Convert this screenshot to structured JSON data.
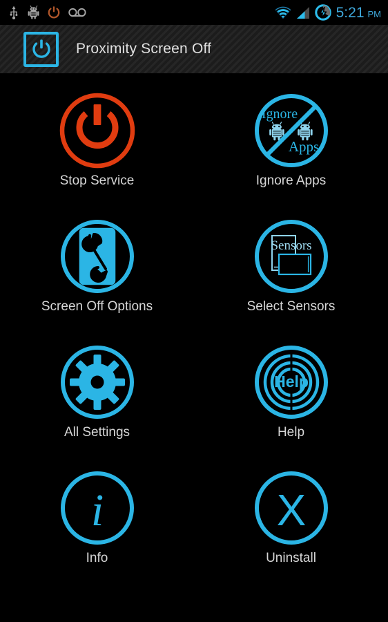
{
  "status_bar": {
    "left_icons": [
      {
        "name": "usb-icon",
        "label": "USB"
      },
      {
        "name": "android-debug-icon",
        "label": "Android debugging"
      },
      {
        "name": "power-notification-icon",
        "label": "Power"
      },
      {
        "name": "voicemail-icon",
        "label": "Voicemail"
      }
    ],
    "right_icons": [
      {
        "name": "wifi-icon",
        "label": "Wi-Fi"
      },
      {
        "name": "signal-icon",
        "label": "Mobile signal"
      },
      {
        "name": "battery-charging-icon",
        "label": "Battery charging"
      }
    ],
    "time": "5:21",
    "ampm": "PM",
    "accent_color": "#3FA9DC"
  },
  "action_bar": {
    "logo_icon": "power-logo-icon",
    "title": "Proximity Screen Off"
  },
  "theme": {
    "background": "#000000",
    "accent_cyan": "#2BB5E5",
    "accent_red": "#E03C10",
    "label_color": "#D6D6D6"
  },
  "grid": {
    "items": [
      {
        "id": "stop-service",
        "label": "Stop Service",
        "icon": "power-off-icon",
        "color": "#E03C10"
      },
      {
        "id": "ignore-apps",
        "label": "Ignore Apps",
        "icon": "no-apps-icon",
        "color": "#2BB5E5"
      },
      {
        "id": "screen-off-options",
        "label": "Screen Off Options",
        "icon": "phone-wrench-icon",
        "color": "#2BB5E5"
      },
      {
        "id": "select-sensors",
        "label": "Select Sensors",
        "icon": "sensors-icon",
        "color": "#2BB5E5"
      },
      {
        "id": "all-settings",
        "label": "All Settings",
        "icon": "gear-icon",
        "color": "#2BB5E5"
      },
      {
        "id": "help",
        "label": "Help",
        "icon": "help-rings-icon",
        "color": "#2BB5E5"
      },
      {
        "id": "info",
        "label": "Info",
        "icon": "info-i-icon",
        "color": "#2BB5E5"
      },
      {
        "id": "uninstall",
        "label": "Uninstall",
        "icon": "x-circle-icon",
        "color": "#2BB5E5"
      }
    ],
    "icon_text": {
      "ignore": "Ignore",
      "apps": "Apps",
      "sensors": "Sensors",
      "help": "Help",
      "info_glyph": "i",
      "uninstall_glyph": "X"
    }
  }
}
